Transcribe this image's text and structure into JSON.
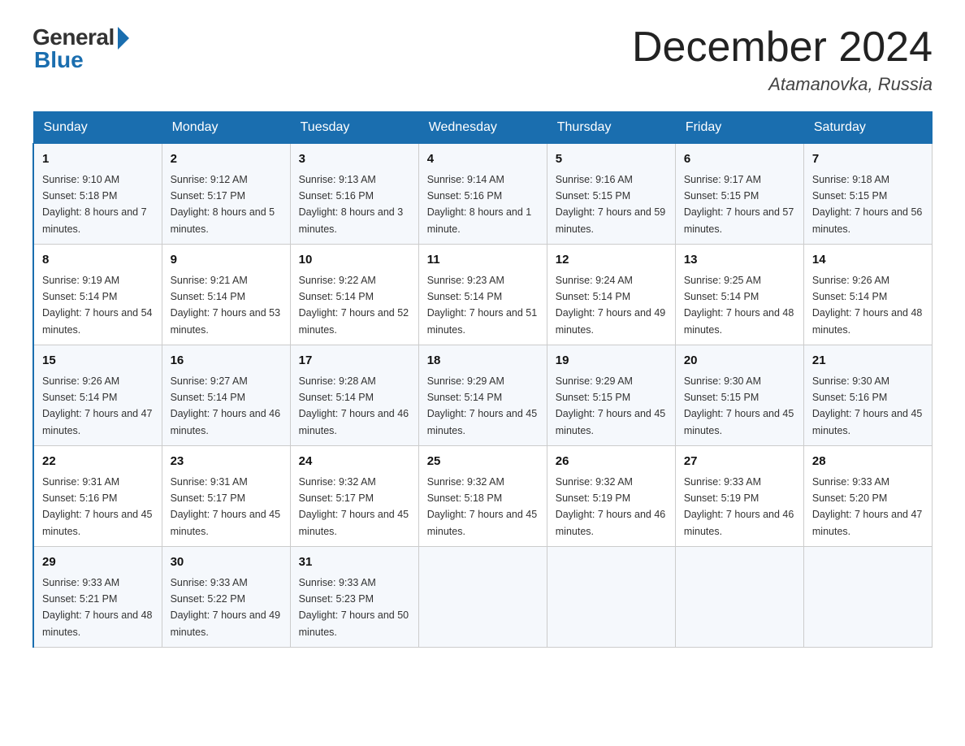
{
  "header": {
    "logo_general": "General",
    "logo_blue": "Blue",
    "month_title": "December 2024",
    "location": "Atamanovka, Russia"
  },
  "days_of_week": [
    "Sunday",
    "Monday",
    "Tuesday",
    "Wednesday",
    "Thursday",
    "Friday",
    "Saturday"
  ],
  "weeks": [
    [
      {
        "day": "1",
        "sunrise": "9:10 AM",
        "sunset": "5:18 PM",
        "daylight": "8 hours and 7 minutes."
      },
      {
        "day": "2",
        "sunrise": "9:12 AM",
        "sunset": "5:17 PM",
        "daylight": "8 hours and 5 minutes."
      },
      {
        "day": "3",
        "sunrise": "9:13 AM",
        "sunset": "5:16 PM",
        "daylight": "8 hours and 3 minutes."
      },
      {
        "day": "4",
        "sunrise": "9:14 AM",
        "sunset": "5:16 PM",
        "daylight": "8 hours and 1 minute."
      },
      {
        "day": "5",
        "sunrise": "9:16 AM",
        "sunset": "5:15 PM",
        "daylight": "7 hours and 59 minutes."
      },
      {
        "day": "6",
        "sunrise": "9:17 AM",
        "sunset": "5:15 PM",
        "daylight": "7 hours and 57 minutes."
      },
      {
        "day": "7",
        "sunrise": "9:18 AM",
        "sunset": "5:15 PM",
        "daylight": "7 hours and 56 minutes."
      }
    ],
    [
      {
        "day": "8",
        "sunrise": "9:19 AM",
        "sunset": "5:14 PM",
        "daylight": "7 hours and 54 minutes."
      },
      {
        "day": "9",
        "sunrise": "9:21 AM",
        "sunset": "5:14 PM",
        "daylight": "7 hours and 53 minutes."
      },
      {
        "day": "10",
        "sunrise": "9:22 AM",
        "sunset": "5:14 PM",
        "daylight": "7 hours and 52 minutes."
      },
      {
        "day": "11",
        "sunrise": "9:23 AM",
        "sunset": "5:14 PM",
        "daylight": "7 hours and 51 minutes."
      },
      {
        "day": "12",
        "sunrise": "9:24 AM",
        "sunset": "5:14 PM",
        "daylight": "7 hours and 49 minutes."
      },
      {
        "day": "13",
        "sunrise": "9:25 AM",
        "sunset": "5:14 PM",
        "daylight": "7 hours and 48 minutes."
      },
      {
        "day": "14",
        "sunrise": "9:26 AM",
        "sunset": "5:14 PM",
        "daylight": "7 hours and 48 minutes."
      }
    ],
    [
      {
        "day": "15",
        "sunrise": "9:26 AM",
        "sunset": "5:14 PM",
        "daylight": "7 hours and 47 minutes."
      },
      {
        "day": "16",
        "sunrise": "9:27 AM",
        "sunset": "5:14 PM",
        "daylight": "7 hours and 46 minutes."
      },
      {
        "day": "17",
        "sunrise": "9:28 AM",
        "sunset": "5:14 PM",
        "daylight": "7 hours and 46 minutes."
      },
      {
        "day": "18",
        "sunrise": "9:29 AM",
        "sunset": "5:14 PM",
        "daylight": "7 hours and 45 minutes."
      },
      {
        "day": "19",
        "sunrise": "9:29 AM",
        "sunset": "5:15 PM",
        "daylight": "7 hours and 45 minutes."
      },
      {
        "day": "20",
        "sunrise": "9:30 AM",
        "sunset": "5:15 PM",
        "daylight": "7 hours and 45 minutes."
      },
      {
        "day": "21",
        "sunrise": "9:30 AM",
        "sunset": "5:16 PM",
        "daylight": "7 hours and 45 minutes."
      }
    ],
    [
      {
        "day": "22",
        "sunrise": "9:31 AM",
        "sunset": "5:16 PM",
        "daylight": "7 hours and 45 minutes."
      },
      {
        "day": "23",
        "sunrise": "9:31 AM",
        "sunset": "5:17 PM",
        "daylight": "7 hours and 45 minutes."
      },
      {
        "day": "24",
        "sunrise": "9:32 AM",
        "sunset": "5:17 PM",
        "daylight": "7 hours and 45 minutes."
      },
      {
        "day": "25",
        "sunrise": "9:32 AM",
        "sunset": "5:18 PM",
        "daylight": "7 hours and 45 minutes."
      },
      {
        "day": "26",
        "sunrise": "9:32 AM",
        "sunset": "5:19 PM",
        "daylight": "7 hours and 46 minutes."
      },
      {
        "day": "27",
        "sunrise": "9:33 AM",
        "sunset": "5:19 PM",
        "daylight": "7 hours and 46 minutes."
      },
      {
        "day": "28",
        "sunrise": "9:33 AM",
        "sunset": "5:20 PM",
        "daylight": "7 hours and 47 minutes."
      }
    ],
    [
      {
        "day": "29",
        "sunrise": "9:33 AM",
        "sunset": "5:21 PM",
        "daylight": "7 hours and 48 minutes."
      },
      {
        "day": "30",
        "sunrise": "9:33 AM",
        "sunset": "5:22 PM",
        "daylight": "7 hours and 49 minutes."
      },
      {
        "day": "31",
        "sunrise": "9:33 AM",
        "sunset": "5:23 PM",
        "daylight": "7 hours and 50 minutes."
      },
      null,
      null,
      null,
      null
    ]
  ],
  "labels": {
    "sunrise": "Sunrise:",
    "sunset": "Sunset:",
    "daylight": "Daylight:"
  }
}
